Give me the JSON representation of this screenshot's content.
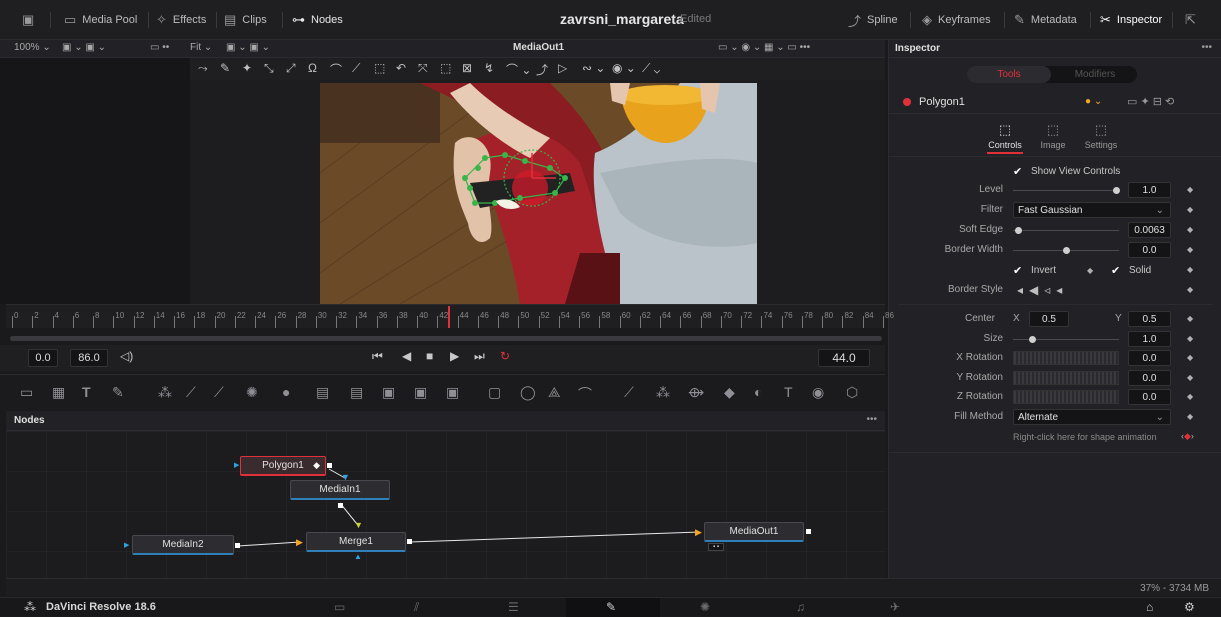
{
  "topbar": {
    "media_pool": "Media Pool",
    "effects": "Effects",
    "clips": "Clips",
    "nodes": "Nodes",
    "project_title": "zavrsni_margareta",
    "project_status": "Edited",
    "spline": "Spline",
    "keyframes": "Keyframes",
    "metadata": "Metadata",
    "inspector": "Inspector"
  },
  "viewer": {
    "zoom": "100%",
    "fit": "Fit",
    "title": "MediaOut1"
  },
  "ruler": {
    "ticks": [
      "0",
      "2",
      "4",
      "6",
      "8",
      "10",
      "12",
      "14",
      "16",
      "18",
      "20",
      "22",
      "24",
      "26",
      "28",
      "30",
      "32",
      "34",
      "36",
      "38",
      "40",
      "42",
      "44",
      "46",
      "48",
      "50",
      "52",
      "54",
      "56",
      "58",
      "60",
      "62",
      "64",
      "66",
      "68",
      "70",
      "72",
      "74",
      "76",
      "78",
      "80",
      "82",
      "84",
      "86"
    ]
  },
  "transport": {
    "start": "0.0",
    "end": "86.0",
    "current": "44.0"
  },
  "nodes_panel": {
    "title": "Nodes",
    "menu": "•••",
    "polygon": "Polygon1",
    "media_in1": "MediaIn1",
    "media_in2": "MediaIn2",
    "merge": "Merge1",
    "media_out": "MediaOut1"
  },
  "inspector": {
    "title": "Inspector",
    "menu": "•••",
    "tab_tools": "Tools",
    "tab_modifiers": "Modifiers",
    "tool_name": "Polygon1",
    "subtabs": [
      "Controls",
      "Image",
      "Settings"
    ],
    "show_view_controls": "Show View Controls",
    "level_label": "Level",
    "level_value": "1.0",
    "filter_label": "Filter",
    "filter_value": "Fast Gaussian",
    "soft_edge_label": "Soft Edge",
    "soft_edge_value": "0.0063",
    "border_width_label": "Border Width",
    "border_width_value": "0.0",
    "invert_label": "Invert",
    "solid_label": "Solid",
    "border_style_label": "Border Style",
    "center_label": "Center",
    "center_x_label": "X",
    "center_x": "0.5",
    "center_y_label": "Y",
    "center_y": "0.5",
    "size_label": "Size",
    "size_value": "1.0",
    "x_rotation_label": "X Rotation",
    "x_rotation_value": "0.0",
    "y_rotation_label": "Y Rotation",
    "y_rotation_value": "0.0",
    "z_rotation_label": "Z Rotation",
    "z_rotation_value": "0.0",
    "fill_method_label": "Fill Method",
    "fill_method_value": "Alternate",
    "animation_hint": "Right-click here for shape animation"
  },
  "status": {
    "memory": "37% - 3734 MB"
  },
  "pagebar": {
    "app_name": "DaVinci Resolve 18.6"
  },
  "colors": {
    "accent_red": "#e0313a",
    "accent_orange": "#f5a623",
    "node_blue": "#2f7fb8"
  }
}
